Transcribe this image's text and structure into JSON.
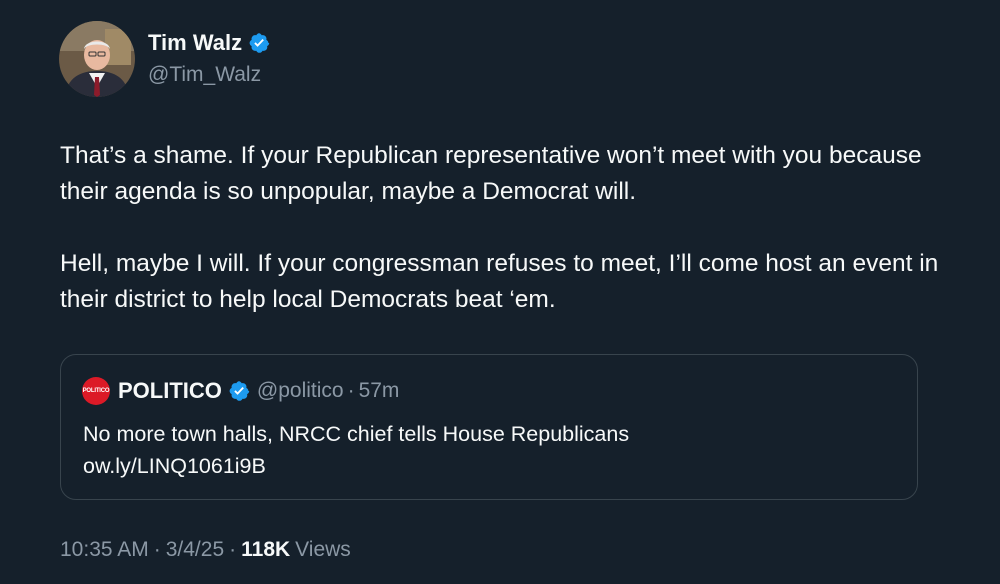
{
  "author": {
    "display_name": "Tim Walz",
    "handle": "@Tim_Walz",
    "avatar_icon": "profile-photo",
    "verified_color": "#1d9bf0"
  },
  "tweet": {
    "paragraphs": [
      "That’s a shame. If your Republican representative won’t meet with you because their agenda is so unpopular, maybe a Democrat will.",
      "Hell, maybe I will. If your congressman refuses to meet, I’ll come host an event in their district to help local Democrats beat ‘em."
    ]
  },
  "quoted_tweet": {
    "avatar_text": "POLITICO",
    "display_name": "POLITICO",
    "handle": "@politico",
    "separator": "·",
    "time": "57m",
    "text": "No more town halls, NRCC chief tells House Republicans ow.ly/LINQ1061i9B",
    "avatar_color": "#dc1a27"
  },
  "meta": {
    "time": "10:35 AM",
    "separator": "·",
    "date": "3/4/25",
    "views_count": "118K",
    "views_label": "Views"
  },
  "colors": {
    "background": "#15202b",
    "text_primary": "#f7f9f9",
    "text_secondary": "#8b98a5",
    "border": "#38444d"
  }
}
